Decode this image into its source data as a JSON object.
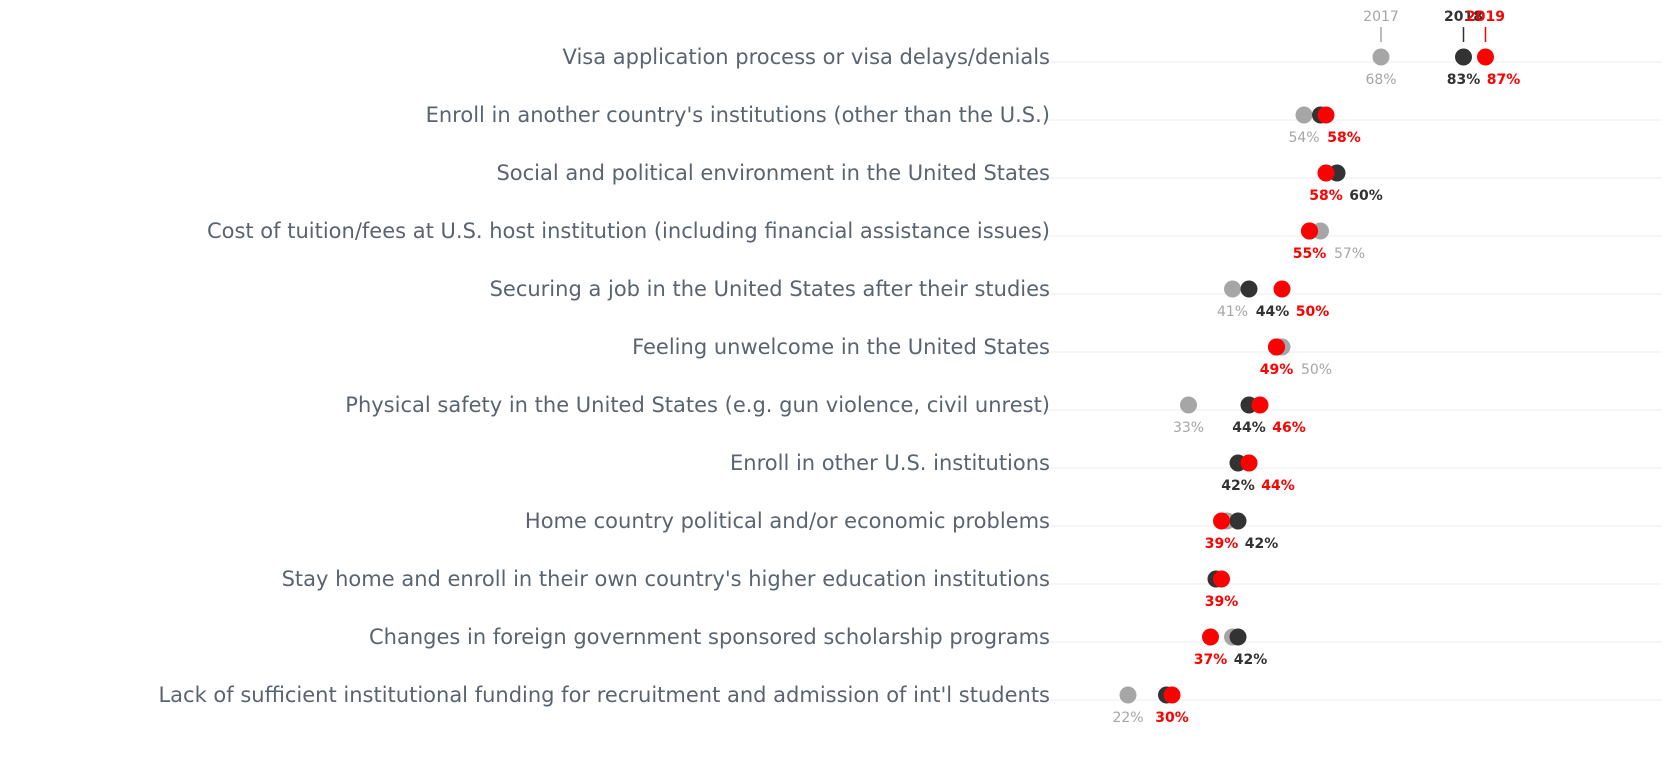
{
  "chart_data": {
    "type": "scatter",
    "title": "",
    "xlabel": "",
    "ylabel": "",
    "xlim": [
      18,
      90
    ],
    "grid": true,
    "legend": "top-right",
    "colors": {
      "2017": "#a6a6a6",
      "2018": "#333333",
      "2019": "#ff0000"
    },
    "series": [
      {
        "name": "2017",
        "values": [
          68,
          54,
          58,
          57,
          41,
          50,
          33,
          44,
          40,
          38,
          41,
          22
        ]
      },
      {
        "name": "2018",
        "values": [
          83,
          57,
          60,
          55,
          44,
          49,
          44,
          42,
          42,
          38,
          42,
          29
        ]
      },
      {
        "name": "2019",
        "values": [
          87,
          58,
          58,
          55,
          50,
          49,
          46,
          44,
          39,
          39,
          37,
          30
        ]
      }
    ],
    "categories": [
      "Visa application process or visa delays/denials",
      "Enroll in another country's institutions (other than the U.S.)",
      "Social and political environment in the United States",
      "Cost of tuition/fees at U.S. host institution (including financial assistance issues)",
      "Securing a job in the United States after their studies",
      "Feeling unwelcome in the United States",
      "Physical safety in the United States (e.g. gun violence, civil unrest)",
      "Enroll in other U.S. institutions",
      "Home country political and/or economic problems",
      "Stay home and enroll in their own country's higher education institutions",
      "Changes in foreign government sponsored scholarship programs",
      "Lack of sufficient institutional funding for recruitment and admission of int'l students"
    ],
    "labels": [
      [
        {
          "s": 0,
          "text": "68%"
        },
        {
          "s": 1,
          "text": "83%"
        },
        {
          "s": 2,
          "text": "87%"
        }
      ],
      [
        {
          "s": 0,
          "text": "54%"
        },
        {
          "s": 2,
          "text": "58%"
        }
      ],
      [
        {
          "s": 2,
          "text": "58%"
        },
        {
          "s": 1,
          "text": "60%"
        }
      ],
      [
        {
          "s": 2,
          "text": "55%"
        },
        {
          "s": 0,
          "text": "57%"
        }
      ],
      [
        {
          "s": 0,
          "text": "41%"
        },
        {
          "s": 1,
          "text": "44%"
        },
        {
          "s": 2,
          "text": "50%"
        }
      ],
      [
        {
          "s": 2,
          "text": "49%"
        },
        {
          "s": 0,
          "text": "50%"
        }
      ],
      [
        {
          "s": 0,
          "text": "33%"
        },
        {
          "s": 1,
          "text": "44%"
        },
        {
          "s": 2,
          "text": "46%"
        }
      ],
      [
        {
          "s": 1,
          "text": "42%"
        },
        {
          "s": 2,
          "text": "44%"
        }
      ],
      [
        {
          "s": 2,
          "text": "39%"
        },
        {
          "s": 1,
          "text": "42%"
        }
      ],
      [
        {
          "s": 2,
          "text": "39%"
        }
      ],
      [
        {
          "s": 2,
          "text": "37%"
        },
        {
          "s": 1,
          "text": "42%"
        }
      ],
      [
        {
          "s": 0,
          "text": "22%"
        },
        {
          "s": 2,
          "text": "30%"
        }
      ]
    ]
  }
}
